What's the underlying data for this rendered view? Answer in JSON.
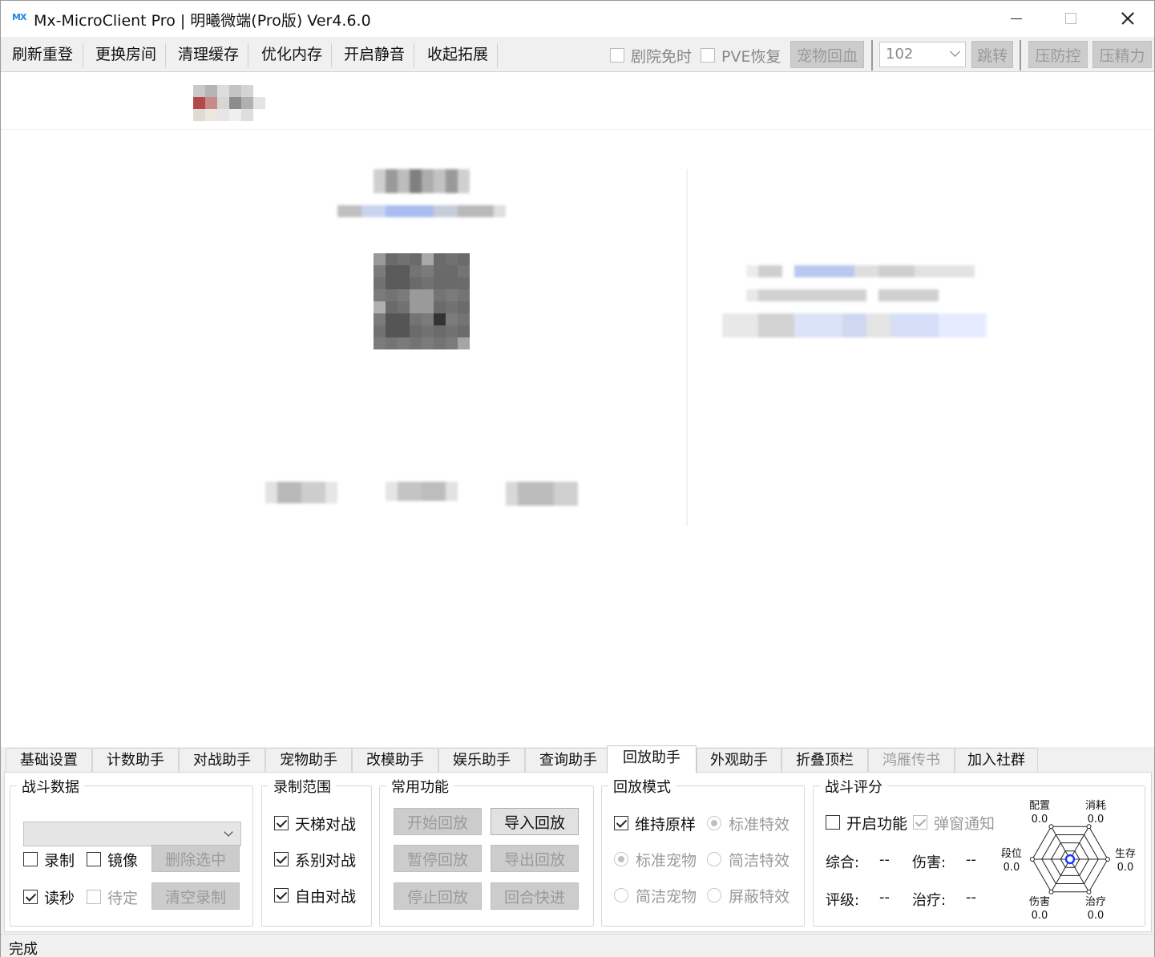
{
  "window": {
    "logo": "MX",
    "title": "Mx-MicroClient Pro | 明曦微端(Pro版)  Ver4.6.0"
  },
  "toolbar": {
    "refresh_login": "刷新重登",
    "change_room": "更换房间",
    "clear_cache": "清理缓存",
    "optimize_memory": "优化内存",
    "enable_mute": "开启静音",
    "collapse_ext": "收起拓展",
    "theater_free": "剧院免时",
    "pve_recover": "PVE恢复",
    "pet_heal": "宠物回血",
    "room_value": "102",
    "jump": "跳转",
    "suppress_defense": "压防控",
    "suppress_energy": "压精力"
  },
  "tabs": [
    {
      "label": "基础设置",
      "active": false,
      "disabled": false
    },
    {
      "label": "计数助手",
      "active": false,
      "disabled": false
    },
    {
      "label": "对战助手",
      "active": false,
      "disabled": false
    },
    {
      "label": "宠物助手",
      "active": false,
      "disabled": false
    },
    {
      "label": "改模助手",
      "active": false,
      "disabled": false
    },
    {
      "label": "娱乐助手",
      "active": false,
      "disabled": false
    },
    {
      "label": "查询助手",
      "active": false,
      "disabled": false
    },
    {
      "label": "回放助手",
      "active": true,
      "disabled": false
    },
    {
      "label": "外观助手",
      "active": false,
      "disabled": false
    },
    {
      "label": "折叠顶栏",
      "active": false,
      "disabled": false
    },
    {
      "label": "鸿雁传书",
      "active": false,
      "disabled": true
    },
    {
      "label": "加入社群",
      "active": false,
      "disabled": false
    }
  ],
  "battle_data": {
    "title": "战斗数据",
    "combo_value": "",
    "record": "录制",
    "mirror": "镜像",
    "delete_selected": "删除选中",
    "read_seconds": "读秒",
    "pending": "待定",
    "clear_records": "清空录制"
  },
  "record_range": {
    "title": "录制范围",
    "ladder": "天梯对战",
    "series": "系别对战",
    "free": "自由对战"
  },
  "common": {
    "title": "常用功能",
    "start_replay": "开始回放",
    "import_replay": "导入回放",
    "pause_replay": "暂停回放",
    "export_replay": "导出回放",
    "stop_replay": "停止回放",
    "round_fast": "回合快进"
  },
  "replay_mode": {
    "title": "回放模式",
    "keep_original": "维持原样",
    "standard_effects": "标准特效",
    "standard_pet": "标准宠物",
    "simple_effects": "简洁特效",
    "simple_pet": "简洁宠物",
    "hide_effects": "屏蔽特效"
  },
  "battle_score": {
    "title": "战斗评分",
    "enable": "开启功能",
    "popup_notify": "弹窗通知",
    "overall_label": "综合:",
    "overall_value": "--",
    "damage_label": "伤害:",
    "damage_value": "--",
    "rating_label": "评级:",
    "rating_value": "--",
    "heal_label": "治疗:",
    "heal_value": "--",
    "radar": [
      {
        "label": "配置",
        "value": "0.0"
      },
      {
        "label": "消耗",
        "value": "0.0"
      },
      {
        "label": "生存",
        "value": "0.0"
      },
      {
        "label": "治疗",
        "value": "0.0"
      },
      {
        "label": "伤害",
        "value": "0.0"
      },
      {
        "label": "段位",
        "value": "0.0"
      }
    ]
  },
  "status": {
    "text": "完成"
  },
  "colors": {
    "accent": "#1e88e5",
    "radar_center": "#1a3cff"
  }
}
